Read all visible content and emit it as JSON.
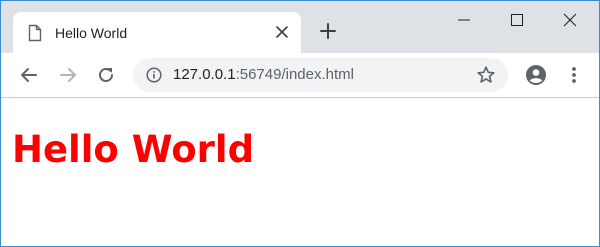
{
  "browser": {
    "tab": {
      "title": "Hello World",
      "favicon_icon": "document-icon",
      "close_icon": "close-icon"
    },
    "new_tab_icon": "plus-icon",
    "window_controls": [
      "minimize-icon",
      "maximize-icon",
      "close-icon"
    ],
    "toolbar": {
      "back_icon": "arrow-back-icon",
      "forward_icon": "arrow-forward-icon",
      "reload_icon": "reload-icon",
      "info_icon": "info-icon",
      "url_host": "127.0.0.1",
      "url_rest": ":56749/index.html",
      "bookmark_icon": "star-icon",
      "account_icon": "account-icon",
      "menu_icon": "more-vert-icon"
    }
  },
  "page": {
    "heading": "Hello World",
    "heading_color": "#ff0000"
  },
  "colors": {
    "tabstrip": "#dee1e6",
    "omnibox": "#f1f3f4",
    "window_border": "#3c8dd0"
  }
}
